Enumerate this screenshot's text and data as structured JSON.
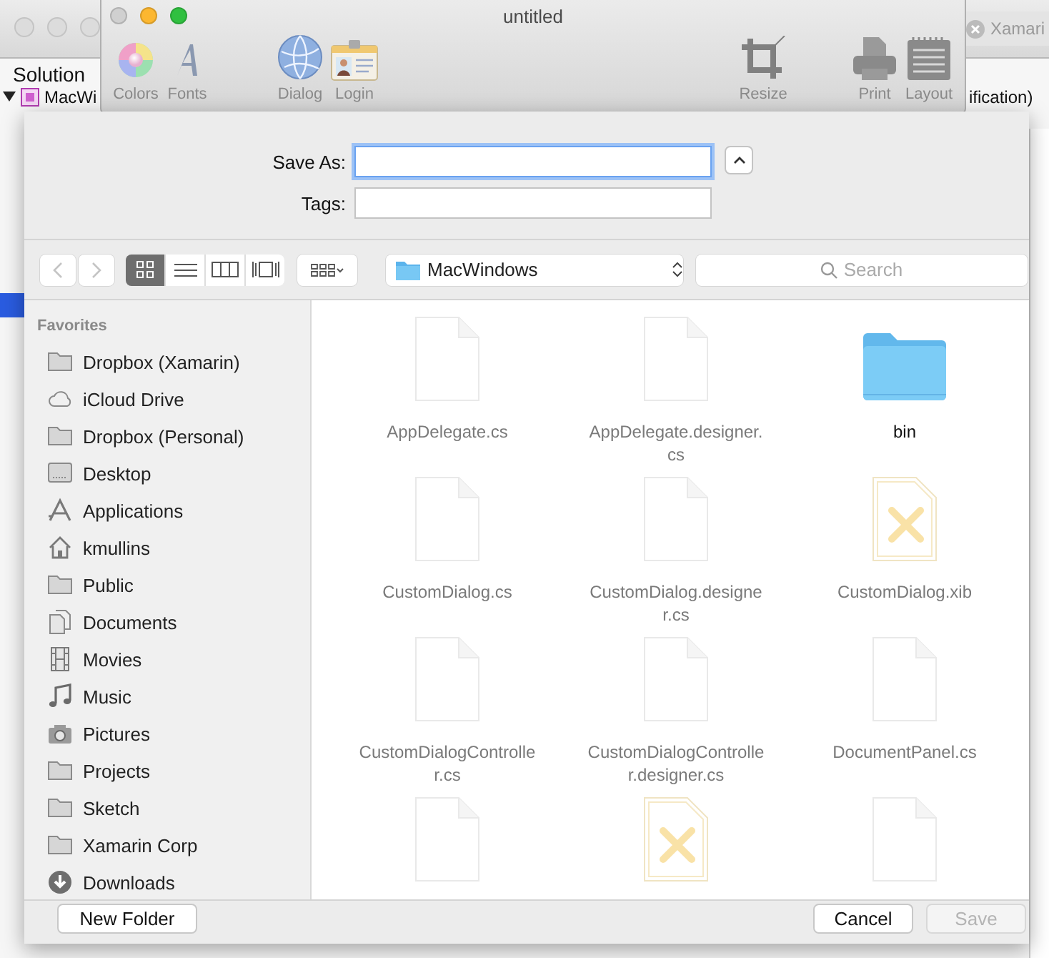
{
  "ide_window": {
    "tab": "Xamari",
    "sidebar_title": "Solution",
    "project": "MacWi",
    "editor_fragment": "ification)",
    "selected_row": true
  },
  "window": {
    "title": "untitled",
    "toolbar": [
      {
        "label": "Colors",
        "kind": "colors"
      },
      {
        "label": "Fonts",
        "kind": "fonts"
      },
      {
        "label": "Dialog",
        "kind": "globe"
      },
      {
        "label": "Login",
        "kind": "id-card"
      },
      {
        "label": "Resize",
        "kind": "crop"
      },
      {
        "label": "Print",
        "kind": "printer"
      },
      {
        "label": "Layout",
        "kind": "notepad"
      }
    ]
  },
  "save_sheet": {
    "save_as": {
      "label": "Save As:",
      "focused": true
    },
    "tags": {
      "label": "Tags:"
    },
    "view_modes": [
      {
        "kind": "icons",
        "selected": true
      },
      {
        "kind": "list",
        "selected": false
      },
      {
        "kind": "columns",
        "selected": false
      },
      {
        "kind": "coverflow",
        "selected": false
      }
    ],
    "location": "MacWindows",
    "search": {
      "placeholder": "Search"
    },
    "sidebar": {
      "heading": "Favorites",
      "items": [
        {
          "label": "Dropbox (Xamarin)",
          "kind": "folder",
          "selected": false
        },
        {
          "label": "iCloud Drive",
          "kind": "cloud",
          "selected": false
        },
        {
          "label": "Dropbox (Personal)",
          "kind": "folder",
          "selected": false
        },
        {
          "label": "Desktop",
          "kind": "desktop",
          "selected": false
        },
        {
          "label": "Applications",
          "kind": "apps",
          "selected": false
        },
        {
          "label": "kmullins",
          "kind": "home",
          "selected": false
        },
        {
          "label": "Public",
          "kind": "folder",
          "selected": false
        },
        {
          "label": "Documents",
          "kind": "documents",
          "selected": false
        },
        {
          "label": "Movies",
          "kind": "movies",
          "selected": false
        },
        {
          "label": "Music",
          "kind": "music",
          "selected": false
        },
        {
          "label": "Pictures",
          "kind": "pictures",
          "selected": false
        },
        {
          "label": "Projects",
          "kind": "folder",
          "selected": false
        },
        {
          "label": "Sketch",
          "kind": "folder",
          "selected": false
        },
        {
          "label": "Xamarin Corp",
          "kind": "folder",
          "selected": false
        },
        {
          "label": "Downloads",
          "kind": "downloads",
          "selected": false
        }
      ]
    },
    "files": [
      {
        "name": "AppDelegate.cs",
        "kind": "document",
        "disabled": true
      },
      {
        "name": "AppDelegate.designer.cs",
        "kind": "document",
        "disabled": true
      },
      {
        "name": "bin",
        "kind": "folder",
        "disabled": false
      },
      {
        "name": "CustomDialog.cs",
        "kind": "document",
        "disabled": true
      },
      {
        "name": "CustomDialog.designer.cs",
        "kind": "document",
        "disabled": true
      },
      {
        "name": "CustomDialog.xib",
        "kind": "xib",
        "disabled": true
      },
      {
        "name": "CustomDialogController.cs",
        "kind": "document",
        "disabled": true
      },
      {
        "name": "CustomDialogController.designer.cs",
        "kind": "document",
        "disabled": true
      },
      {
        "name": "DocumentPanel.cs",
        "kind": "document",
        "disabled": true
      },
      {
        "kind": "document",
        "disabled": true
      },
      {
        "kind": "xib",
        "disabled": true
      },
      {
        "kind": "document",
        "disabled": true
      }
    ],
    "buttons": [
      {
        "label": "New Folder",
        "disabled": false,
        "kind": "new-folder"
      },
      {
        "label": "Cancel",
        "disabled": false,
        "kind": "cancel"
      },
      {
        "label": "Save",
        "disabled": true,
        "kind": "save"
      }
    ]
  }
}
